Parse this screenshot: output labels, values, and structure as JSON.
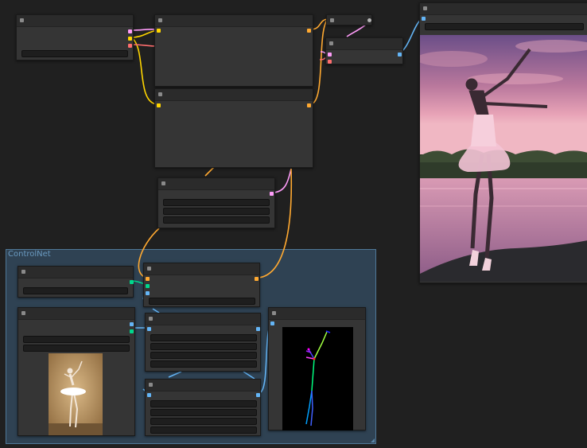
{
  "window": {
    "background_color": "#1f1f1f",
    "node_color": "#353535"
  },
  "group": {
    "title": "ControlNet",
    "color": "#4f7898"
  },
  "wire_colors": {
    "model": "#ffb33b",
    "clip": "#ffd500",
    "conditioning": "#ffa931",
    "latent": "#ff9cf9",
    "vae": "#ff6e6e",
    "image": "#64b5f6",
    "control_net": "#00d78d"
  },
  "nodes": [
    {
      "id": "checkpoint-loader",
      "icon": "node-collapse-dot"
    },
    {
      "id": "positive-prompt",
      "icon": "node-collapse-dot"
    },
    {
      "id": "negative-prompt",
      "icon": "node-collapse-dot"
    },
    {
      "id": "empty-latent",
      "icon": "node-collapse-dot"
    },
    {
      "id": "ksampler",
      "icon": "node-collapse-dot"
    },
    {
      "id": "vae-decode",
      "icon": "node-collapse-dot"
    },
    {
      "id": "save-image",
      "icon": "node-collapse-dot"
    },
    {
      "id": "controlnet-loader",
      "icon": "node-collapse-dot"
    },
    {
      "id": "controlnet-apply",
      "icon": "node-collapse-dot"
    },
    {
      "id": "load-image",
      "icon": "node-collapse-dot"
    },
    {
      "id": "openpose-preprocessor",
      "icon": "node-collapse-dot"
    },
    {
      "id": "image-scale",
      "icon": "node-collapse-dot"
    },
    {
      "id": "preview-image",
      "icon": "node-collapse-dot"
    }
  ]
}
